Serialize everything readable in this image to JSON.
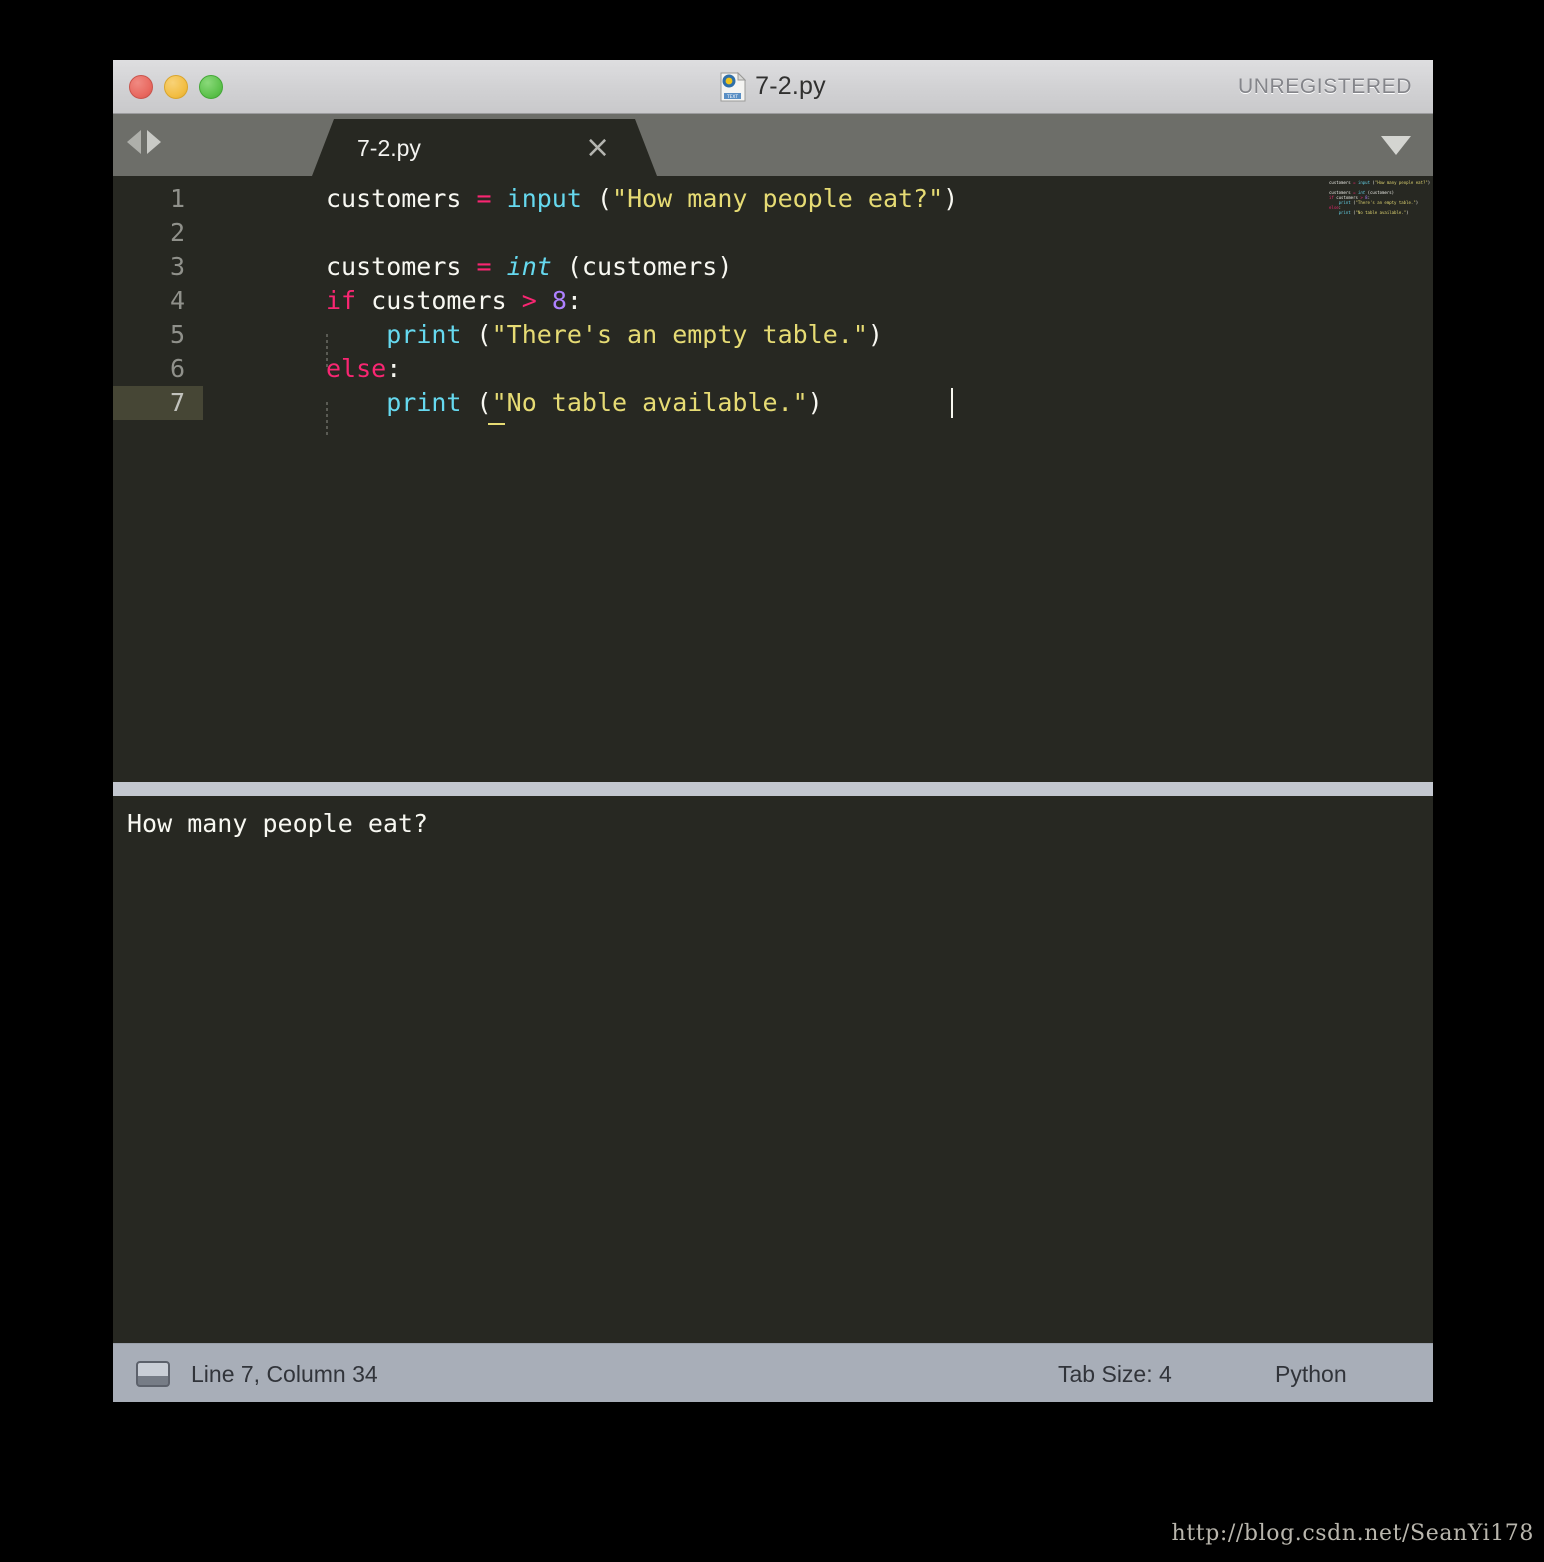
{
  "window": {
    "titlebar": {
      "title": "7-2.py",
      "file_icon": "python-document-icon",
      "license_status": "UNREGISTERED",
      "buttons": {
        "close": "close-window-button",
        "minimize": "minimize-window-button",
        "zoom": "zoom-window-button"
      }
    },
    "tabbar": {
      "nav_back_icon": "arrow-left-icon",
      "nav_forward_icon": "arrow-right-icon",
      "tabs": [
        {
          "label": "7-2.py",
          "close_glyph": "×",
          "active": true
        }
      ],
      "dropdown_glyph": "▼"
    }
  },
  "editor": {
    "line_numbers": [
      "1",
      "2",
      "3",
      "4",
      "5",
      "6",
      "7"
    ],
    "active_line": 7,
    "lines": [
      {
        "number": "1",
        "tokens": [
          {
            "text": "customers ",
            "type": "plain"
          },
          {
            "text": "=",
            "type": "operator"
          },
          {
            "text": " ",
            "type": "plain"
          },
          {
            "text": "input",
            "type": "function"
          },
          {
            "text": " (",
            "type": "punctuation"
          },
          {
            "text": "\"How many people eat?\"",
            "type": "string"
          },
          {
            "text": ")",
            "type": "punctuation"
          }
        ]
      },
      {
        "number": "2",
        "tokens": []
      },
      {
        "number": "3",
        "tokens": [
          {
            "text": "customers ",
            "type": "plain"
          },
          {
            "text": "=",
            "type": "operator"
          },
          {
            "text": " ",
            "type": "plain"
          },
          {
            "text": "int",
            "type": "function-italic"
          },
          {
            "text": " (customers)",
            "type": "punctuation"
          }
        ]
      },
      {
        "number": "4",
        "tokens": [
          {
            "text": "if",
            "type": "keyword"
          },
          {
            "text": " customers ",
            "type": "plain"
          },
          {
            "text": ">",
            "type": "operator"
          },
          {
            "text": " ",
            "type": "plain"
          },
          {
            "text": "8",
            "type": "number"
          },
          {
            "text": ":",
            "type": "punctuation"
          }
        ]
      },
      {
        "number": "5",
        "tokens": [
          {
            "text": "    ",
            "type": "plain"
          },
          {
            "text": "print",
            "type": "function"
          },
          {
            "text": " (",
            "type": "punctuation"
          },
          {
            "text": "\"There's an empty table.\"",
            "type": "string"
          },
          {
            "text": ")",
            "type": "punctuation"
          }
        ]
      },
      {
        "number": "6",
        "tokens": [
          {
            "text": "else",
            "type": "keyword"
          },
          {
            "text": ":",
            "type": "punctuation"
          }
        ]
      },
      {
        "number": "7",
        "tokens": [
          {
            "text": "    ",
            "type": "plain"
          },
          {
            "text": "print",
            "type": "function"
          },
          {
            "text": " (",
            "type": "punctuation"
          },
          {
            "text": "\"No table available.\"",
            "type": "string"
          },
          {
            "text": ")",
            "type": "punctuation"
          }
        ]
      }
    ],
    "plain_text_lines": [
      "customers = input (\"How many people eat?\")",
      "",
      "customers = int (customers)",
      "if customers > 8:",
      "    print (\"There's an empty table.\")",
      "else:",
      "    print (\"No table available.\")"
    ],
    "colors": {
      "background": "#272822",
      "foreground": "#f8f8f2",
      "keyword": "#f92672",
      "function": "#66d9ef",
      "string": "#e6db74",
      "number": "#ae81ff",
      "gutter_text": "#90918b",
      "active_line_gutter": "#464635"
    }
  },
  "console": {
    "output_lines": [
      "How many people eat?"
    ]
  },
  "statusbar": {
    "panel_icon": "console-panel-icon",
    "cursor_position": "Line 7, Column 34",
    "tab_size": "Tab Size: 4",
    "language": "Python"
  },
  "watermark": {
    "text": "http://blog.csdn.net/SeanYi178"
  }
}
